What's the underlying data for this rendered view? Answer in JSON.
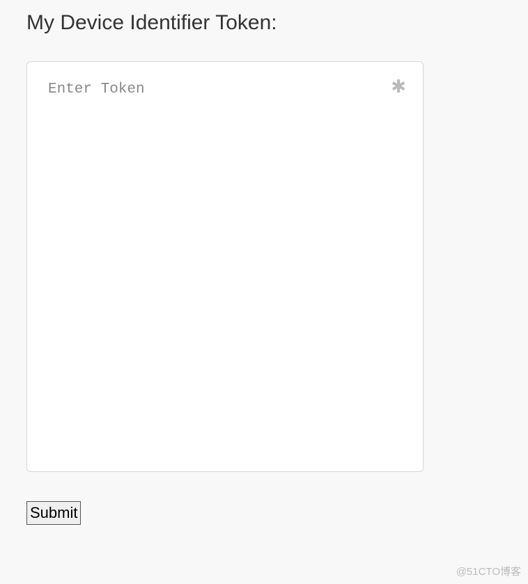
{
  "header": {
    "title": "My Device Identifier Token:"
  },
  "form": {
    "token_placeholder": "Enter Token",
    "token_value": "",
    "required_symbol": "✱",
    "submit_label": "Submit"
  },
  "watermark": {
    "text": "@51CTO博客"
  }
}
